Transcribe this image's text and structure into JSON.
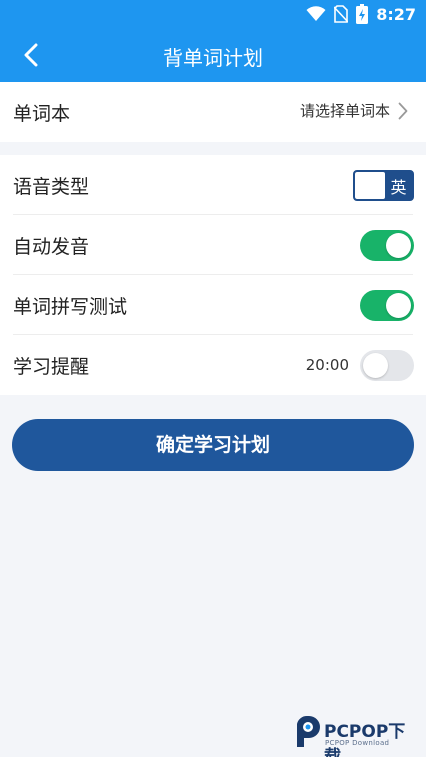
{
  "status_bar": {
    "time": "8:27",
    "icons": [
      "wifi-icon",
      "no-sim-icon",
      "battery-charging-icon"
    ]
  },
  "nav": {
    "title": "背单词计划",
    "back_icon": "chevron-left-icon"
  },
  "wordbook": {
    "label": "单词本",
    "value": "请选择单词本",
    "icon": "chevron-right-icon"
  },
  "settings": {
    "voice_type": {
      "label": "语音类型",
      "value": "英"
    },
    "auto_pronounce": {
      "label": "自动发音",
      "state": "on"
    },
    "spelling_test": {
      "label": "单词拼写测试",
      "state": "on"
    },
    "study_reminder": {
      "label": "学习提醒",
      "time": "20:00",
      "state": "off"
    }
  },
  "confirm_button": {
    "label": "确定学习计划"
  },
  "colors": {
    "header": "#1e96f0",
    "primary_button": "#1f579c",
    "switch_on": "#18b369",
    "switch_off": "#e4e6ea",
    "background": "#f3f5f9"
  },
  "watermark": {
    "text": "PCPOP下载",
    "subtext": "PCPOP Download"
  }
}
